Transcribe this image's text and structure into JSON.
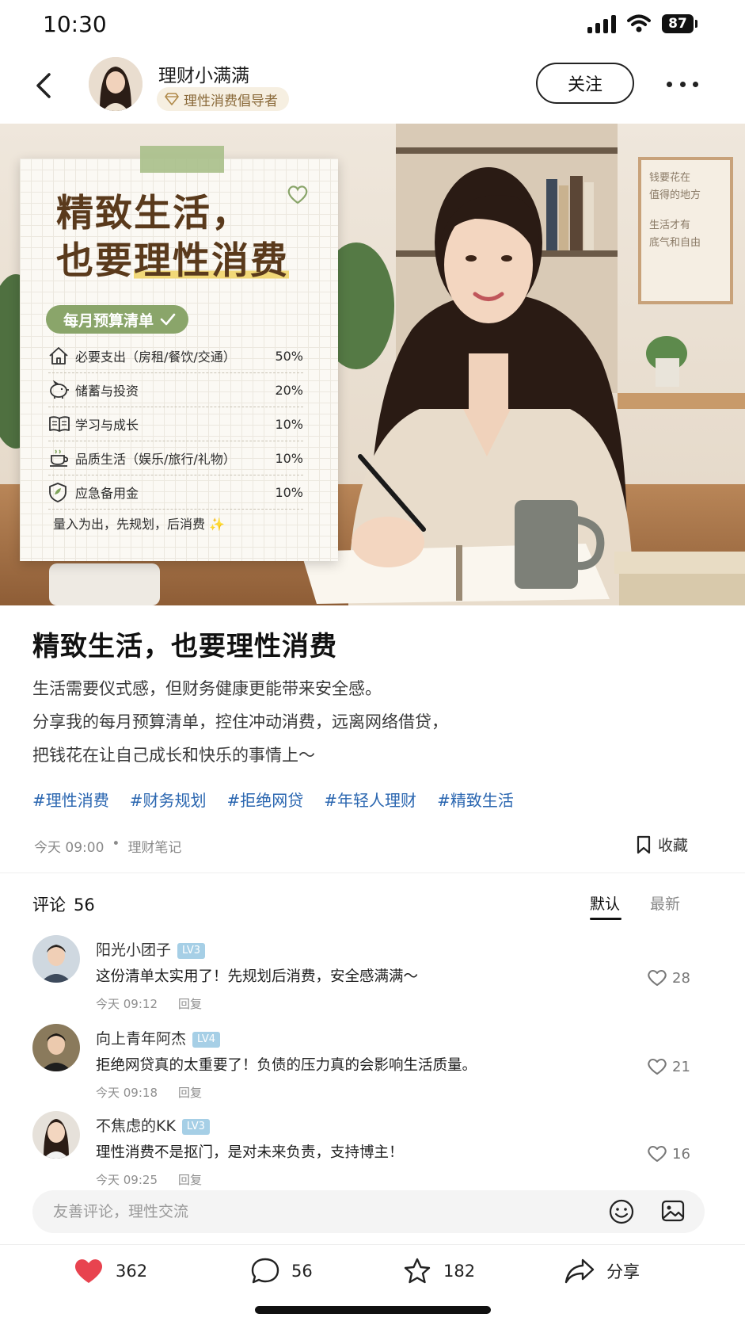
{
  "status_bar": {
    "time": "10:30",
    "battery": "87"
  },
  "header": {
    "author_name": "理财小满满",
    "author_badge": "理性消费倡导者",
    "follow_label": "关注"
  },
  "hero": {
    "card_title_line1": "精致生活，",
    "card_title_line2_prefix": "也要",
    "card_title_line2_highlight": "理性消费",
    "budget_tag": "每月预算清单",
    "budget_items": [
      {
        "icon": "house-icon",
        "label": "必要支出（房租/餐饮/交通）",
        "value": "50%"
      },
      {
        "icon": "piggy-bank-icon",
        "label": "储蓄与投资",
        "value": "20%"
      },
      {
        "icon": "book-icon",
        "label": "学习与成长",
        "value": "10%"
      },
      {
        "icon": "coffee-cup-icon",
        "label": "品质生活（娱乐/旅行/礼物）",
        "value": "10%"
      },
      {
        "icon": "shield-icon",
        "label": "应急备用金",
        "value": "10%"
      }
    ],
    "slogan": "量入为出，先规划，后消费 ✨",
    "wall_frame_lines": [
      "钱要花在",
      "值得的地方",
      "",
      "生活才有",
      "底气和自由"
    ]
  },
  "post": {
    "title": "精致生活，也要理性消费",
    "body": [
      "生活需要仪式感，但财务健康更能带来安全感。",
      "分享我的每月预算清单，控住冲动消费，远离网络借贷，",
      "把钱花在让自己成长和快乐的事情上～"
    ],
    "tags": [
      "#理性消费",
      "#财务规划",
      "#拒绝网贷",
      "#年轻人理财",
      "#精致生活"
    ],
    "time": "今天 09:00",
    "category": "理财笔记",
    "favorite_label": "收藏"
  },
  "comments": {
    "label": "评论",
    "count": "56",
    "sort_default": "默认",
    "sort_latest": "最新",
    "reply_label": "回复",
    "items": [
      {
        "name": "阳光小团子",
        "level": "LV3",
        "text": "这份清单太实用了！先规划后消费，安全感满满～",
        "time": "今天 09:12",
        "likes": "28"
      },
      {
        "name": "向上青年阿杰",
        "level": "LV4",
        "text": "拒绝网贷真的太重要了！负债的压力真的会影响生活质量。",
        "time": "今天 09:18",
        "likes": "21"
      },
      {
        "name": "不焦虑的KK",
        "level": "LV3",
        "text": "理性消费不是抠门，是对未来负责，支持博主！",
        "time": "今天 09:25",
        "likes": "16"
      }
    ],
    "input_placeholder": "友善评论，理性交流"
  },
  "bottom_bar": {
    "likes": "362",
    "comments": "56",
    "stars": "182",
    "share_label": "分享"
  },
  "colors": {
    "tag_blue": "#2a66b0",
    "like_red": "#e8434f",
    "card_green": "#8aa56a",
    "title_brown": "#5a3a1c"
  }
}
